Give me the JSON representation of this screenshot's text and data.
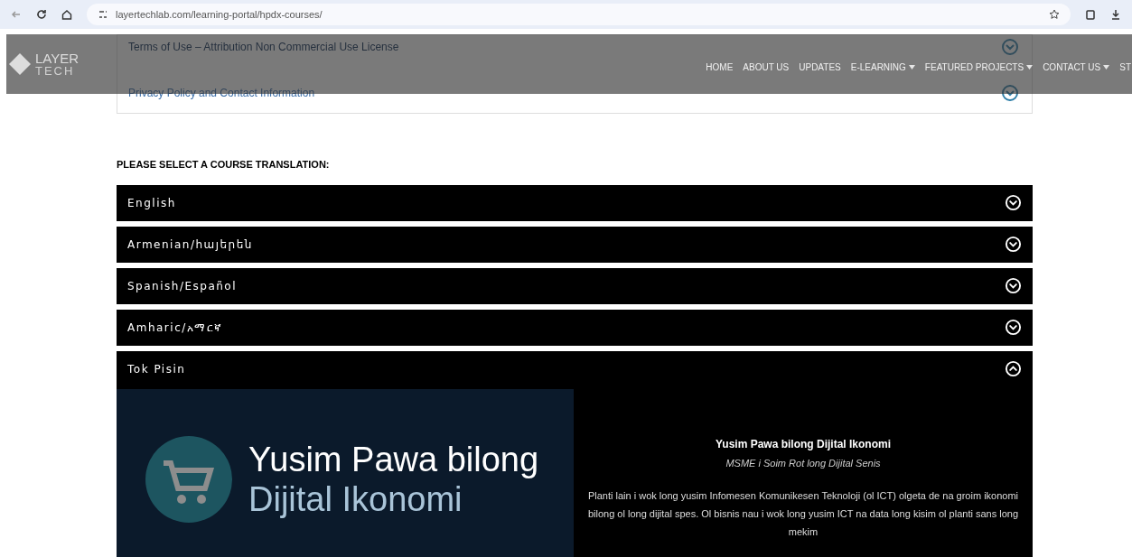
{
  "browser": {
    "url": "layertechlab.com/learning-portal/hpdx-courses/"
  },
  "navbar": {
    "logo": {
      "line_1": "LAYER",
      "line_2": "TECH"
    },
    "items": [
      {
        "label": "HOME",
        "has_dropdown": false
      },
      {
        "label": "ABOUT US",
        "has_dropdown": false
      },
      {
        "label": "UPDATES",
        "has_dropdown": false
      },
      {
        "label": "E-LEARNING",
        "has_dropdown": true
      },
      {
        "label": "FEATURED PROJECTS",
        "has_dropdown": true
      },
      {
        "label": "CONTACT US",
        "has_dropdown": true
      },
      {
        "label": "ST",
        "has_dropdown": false
      }
    ]
  },
  "info_links": [
    {
      "label": "Terms of Use – Attribution Non Commercial Use License",
      "expanded": false
    },
    {
      "label": "Privacy Policy and Contact Information",
      "expanded": false
    }
  ],
  "translations": {
    "heading": "PLEASE SELECT A COURSE TRANSLATION:",
    "items": [
      {
        "label": "English",
        "expanded": false
      },
      {
        "label": "Armenian/հայերեն",
        "expanded": false
      },
      {
        "label": "Spanish/Español",
        "expanded": false
      },
      {
        "label": "Amharic/አማርኛ",
        "expanded": false
      },
      {
        "label": "Tok Pisin",
        "expanded": true,
        "course": {
          "cover_title_1": "Yusim Pawa bilong",
          "cover_title_2": "Dijital Ikonomi",
          "title": "Yusim Pawa bilong Dijital Ikonomi",
          "subtitle": "MSME i Soim Rot long Dijital Senis",
          "description": "Planti lain i wok long yusim Infomesen Komunikesen Teknoloji (ol ICT) olgeta de na groim ikonomi bilong ol long dijital spes. Ol bisnis nau i wok long yusim ICT na data long kisim ol planti sans long mekim"
        }
      }
    ]
  }
}
